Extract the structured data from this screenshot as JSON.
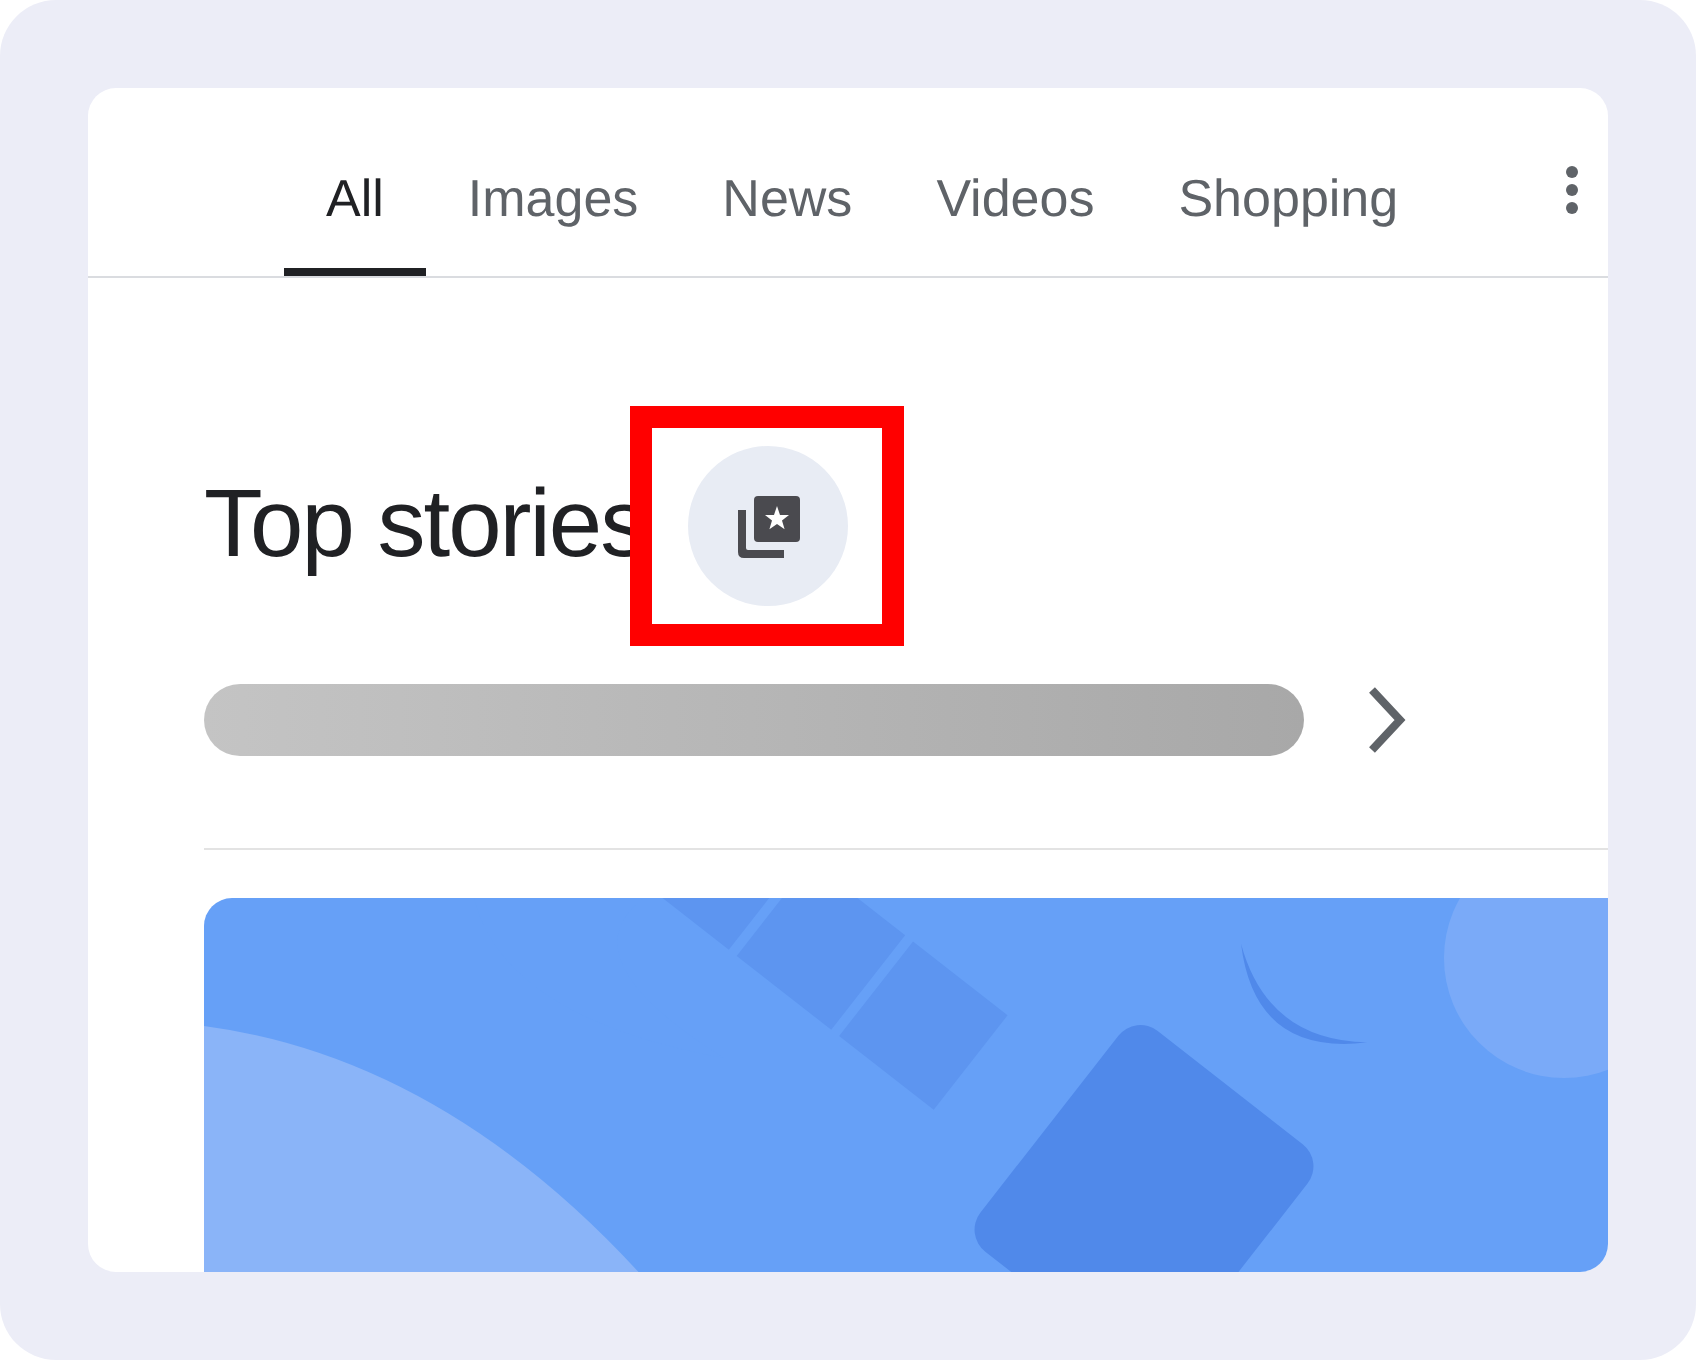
{
  "tabs": [
    {
      "label": "All",
      "selected": true
    },
    {
      "label": "Images",
      "selected": false
    },
    {
      "label": "News",
      "selected": false
    },
    {
      "label": "Videos",
      "selected": false
    },
    {
      "label": "Shopping",
      "selected": false
    }
  ],
  "section": {
    "title": "Top stories",
    "highlighted": true
  }
}
